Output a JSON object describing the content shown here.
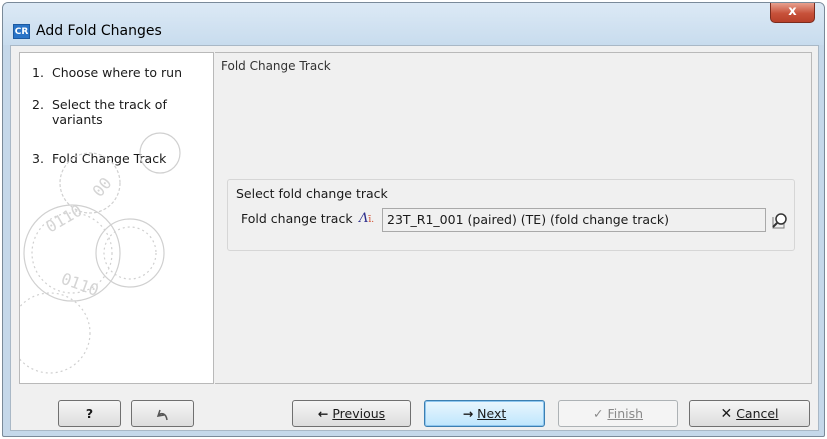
{
  "window": {
    "title": "Add Fold Changes",
    "app_icon_text": "CR",
    "close_glyph": "x"
  },
  "steps": [
    {
      "num": "1.",
      "label": "Choose where to run"
    },
    {
      "num": "2.",
      "label": "Select the track of variants"
    },
    {
      "num": "3.",
      "label": "Fold Change Track"
    }
  ],
  "panel": {
    "title": "Fold Change Track",
    "group_title": "Select fold change track",
    "field_label": "Fold change track",
    "field_value": "23T_R1_001 (paired) (TE) (fold change track)"
  },
  "buttons": {
    "help": "?",
    "previous": "Previous",
    "next": "Next",
    "finish": "Finish",
    "cancel": "Cancel"
  }
}
